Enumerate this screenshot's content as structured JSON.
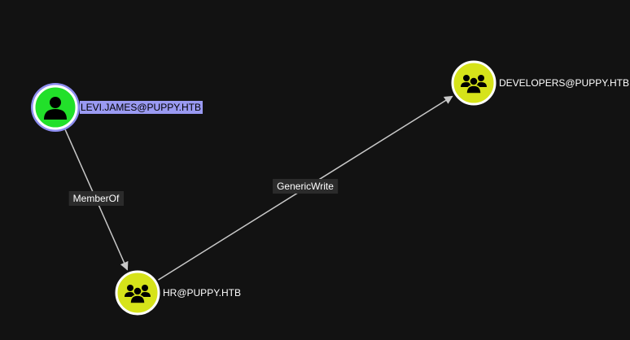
{
  "colors": {
    "background": "#121212",
    "edge": "#c8c8c8",
    "user_node_fill": "#22e02a",
    "group_node_fill": "#d6e31a",
    "node_border": "#ffffff",
    "selected_ring": "#8d8df0",
    "selected_label_bg": "#9a9af2",
    "edge_label_bg": "#2b2b2b",
    "node_label_text": "#ffffff"
  },
  "nodes": [
    {
      "id": "levi",
      "label": "LEVI.JAMES@PUPPY.HTB",
      "type": "user",
      "icon": "user-icon",
      "selected": true
    },
    {
      "id": "developers",
      "label": "DEVELOPERS@PUPPY.HTB",
      "type": "group",
      "icon": "group-icon",
      "selected": false
    },
    {
      "id": "hr",
      "label": "HR@PUPPY.HTB",
      "type": "group",
      "icon": "group-icon",
      "selected": false
    }
  ],
  "edges": [
    {
      "id": "memberof",
      "source": "levi",
      "target": "hr",
      "label": "MemberOf"
    },
    {
      "id": "genericwrite",
      "source": "hr",
      "target": "developers",
      "label": "GenericWrite"
    }
  ]
}
